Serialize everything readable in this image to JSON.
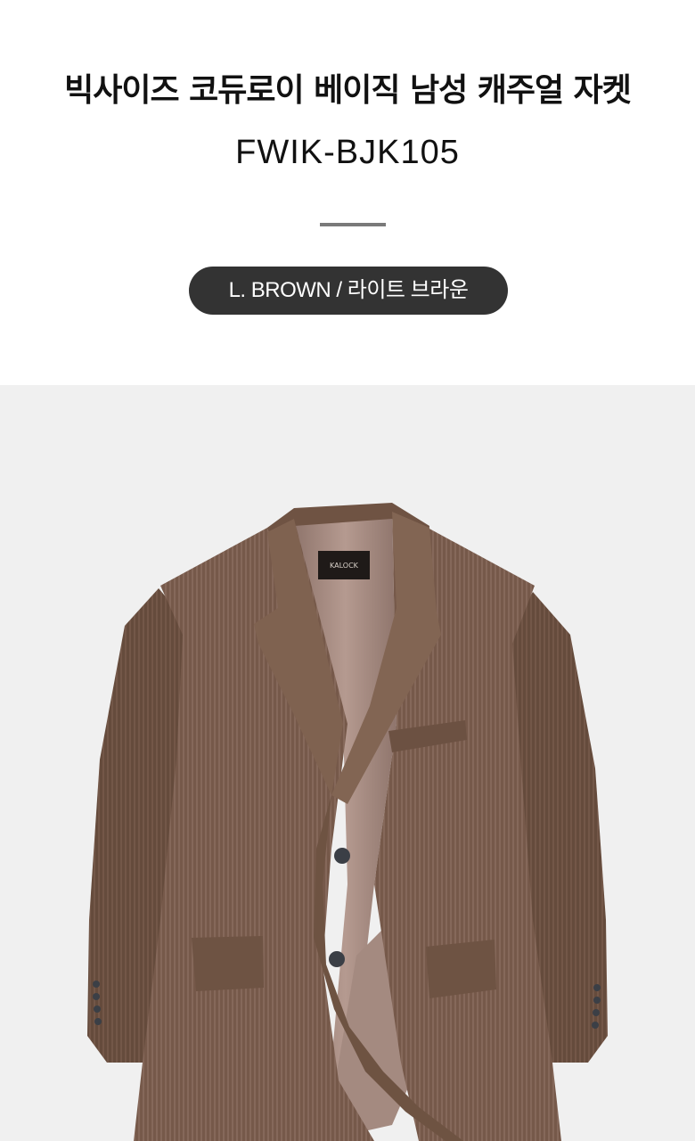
{
  "product": {
    "title": "빅사이즈 코듀로이 베이직 남성 캐주얼 자켓",
    "code": "FWIK-BJK105",
    "color_option": "L. BROWN / 라이트 브라운"
  },
  "photo": {
    "brand_label": "KALOCK",
    "colors": {
      "background": "#f0f0f0",
      "jacket": "#7a5e4d",
      "jacket_dark": "#654b3c",
      "jacket_light": "#8a6d5b",
      "lining": "#a98f86",
      "lining_dark": "#8f756c",
      "button": "#3b3f46"
    }
  }
}
